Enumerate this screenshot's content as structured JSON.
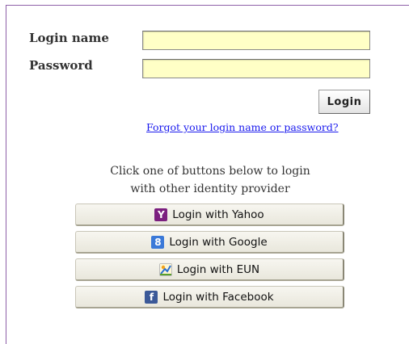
{
  "form": {
    "login_label": "Login name",
    "password_label": "Password",
    "login_value": "",
    "password_value": "",
    "login_button": "Login",
    "forgot_link": "Forgot your login name or password?"
  },
  "providers": {
    "hint_line1": "Click one of buttons below to login",
    "hint_line2": "with other identity provider",
    "yahoo": {
      "label": "Login with Yahoo",
      "icon": "yahoo-icon",
      "glyph": "Y"
    },
    "google": {
      "label": "Login with Google",
      "icon": "google-icon",
      "glyph": "8"
    },
    "eun": {
      "label": "Login with EUN",
      "icon": "eun-icon"
    },
    "facebook": {
      "label": "Login with Facebook",
      "icon": "facebook-icon",
      "glyph": "f"
    }
  },
  "colors": {
    "frame_border": "#8e5fa8",
    "field_background": "#ffffc6",
    "link": "#1a1aee",
    "yahoo": "#7b1f7f",
    "google": "#3b79d8",
    "facebook": "#3b5998"
  }
}
